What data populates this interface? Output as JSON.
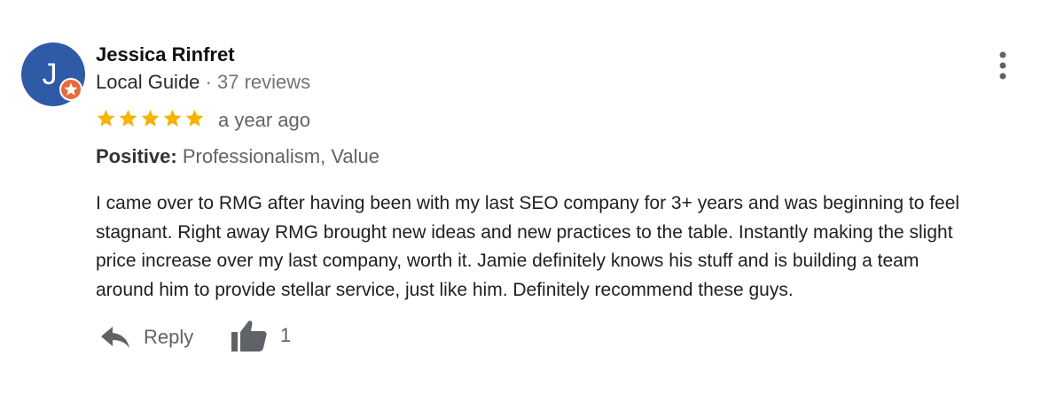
{
  "review": {
    "author": {
      "initial": "J",
      "name": "Jessica Rinfret",
      "guide_label": "Local Guide",
      "separator": " · ",
      "reviews_count": "37 reviews",
      "avatar_color": "#2e5aa6",
      "badge_color": "#e8693c"
    },
    "rating": 5,
    "star_color": "#f4b400",
    "time": "a year ago",
    "highlights": {
      "label": "Positive:",
      "value": "Professionalism, Value"
    },
    "text_lines": [
      "I came over to RMG after having been with my last SEO company for 3+ years and was beginning to feel",
      "stagnant. Right away RMG brought new ideas and new practices to the table. Instantly making the slight",
      "price increase over my last company, worth it. Jamie definitely knows his stuff and is building a team",
      "around him to provide stellar service, just like him. Definitely recommend these guys."
    ],
    "actions": {
      "reply_label": "Reply",
      "like_count": "1"
    },
    "icons": {
      "more": "more-vert-icon",
      "reply": "reply-arrow-icon",
      "like": "thumbs-up-icon",
      "star": "star-icon",
      "badge": "local-guide-badge-icon"
    }
  }
}
